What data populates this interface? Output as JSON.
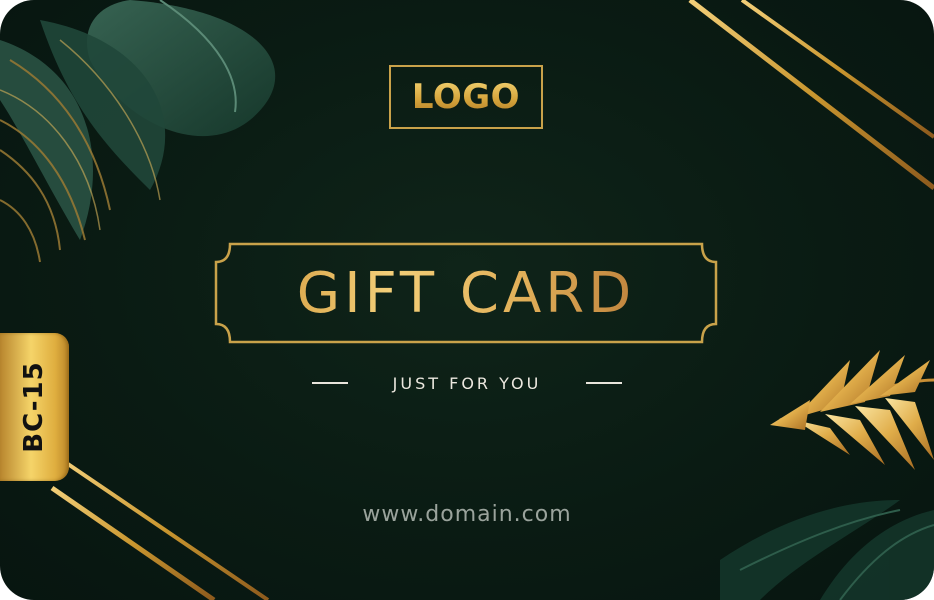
{
  "card": {
    "logo_text": "LOGO",
    "title": "GIFT CARD",
    "tagline": "JUST FOR YOU",
    "website": "www.domain.com",
    "code_tab": "BC-15"
  },
  "colors": {
    "background": "#0a1b13",
    "gold": "#d6a53c",
    "light_text": "#ece8df",
    "muted_text": "#9aa39c"
  },
  "icons": {
    "top_left": "tropical-leaves-icon",
    "bottom_right": "golden-palm-leaves-icon"
  }
}
